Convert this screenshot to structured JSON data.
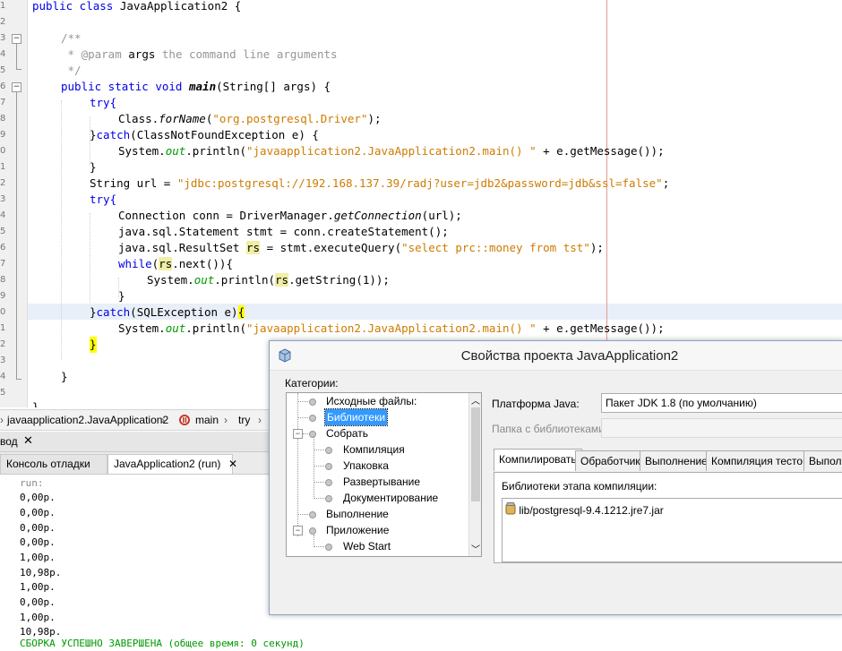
{
  "editor": {
    "gutter_numbers": [
      "1",
      "2",
      "3",
      "4",
      "5",
      "6",
      "7",
      "8",
      "9",
      "0",
      "1",
      "2",
      "3",
      "4",
      "5",
      "6",
      "7",
      "8",
      "9",
      "0",
      "1",
      "2",
      "3",
      "4",
      "5",
      "6"
    ],
    "lines": {
      "l1": {
        "kw": "public class ",
        "rest": "JavaApplication2 {"
      },
      "l3": "/**",
      "l4a": " * @param ",
      "l4b": "args",
      "l4c": " the command line arguments",
      "l5": " */",
      "l6a": "public static void ",
      "l6b": "main",
      "l6c": "(String[] args) {",
      "l7": "try{",
      "l8a": "Class.",
      "l8b": "forName",
      "l8c": "(",
      "l8d": "\"org.postgresql.Driver\"",
      "l8e": ");",
      "l9a": "}",
      "l9b": "catch",
      "l9c": "(ClassNotFoundException e) {",
      "l10a": "System.",
      "l10b": "out",
      "l10c": ".println(",
      "l10d": "\"javaapplication2.JavaApplication2.main() \"",
      "l10e": " + e.getMessage());",
      "l11": "}",
      "l12a": "String url = ",
      "l12b": "\"jdbc:postgresql://192.168.137.39/radj?user=jdb2&password=jdb&ssl=false\"",
      "l12c": ";",
      "l13": "try{",
      "l14a": "Connection conn = DriverManager.",
      "l14b": "getConnection",
      "l14c": "(url);",
      "l15": "java.sql.Statement stmt = conn.createStatement();",
      "l16a": "java.sql.ResultSet ",
      "l16b": "rs",
      "l16c": " = stmt.executeQuery(",
      "l16d": "\"select prc::money from tst\"",
      "l16e": ");",
      "l17a": "while",
      "l17b": "(",
      "l17c": "rs",
      "l17d": ".next()){",
      "l18a": "System.",
      "l18b": "out",
      "l18c": ".println(",
      "l18d": "rs",
      "l18e": ".getString(1));",
      "l19": "}",
      "l20a": "}",
      "l20b": "catch",
      "l20c": "(SQLException e)",
      "l20d": "{",
      "l21a": "System.",
      "l21b": "out",
      "l21c": ".println(",
      "l21d": "\"javaapplication2.JavaApplication2.main() \"",
      "l21e": " + e.getMessage());",
      "l22": "}",
      "l23": "}",
      "l24": "}"
    }
  },
  "breadcrumb": {
    "items": [
      "javaapplication2.JavaApplication2",
      "main",
      "try"
    ]
  },
  "output_window": {
    "title_fragment": "вод",
    "tabs": [
      "Консоль отладки",
      "JavaApplication2 (run)"
    ],
    "lines": [
      "run:",
      "0,00р.",
      "0,00р.",
      "0,00р.",
      "0,00р.",
      "1,00р.",
      "10,98р.",
      "1,00р.",
      "0,00р.",
      "1,00р.",
      "10,98р.",
      "СБОРКА УСПЕШНО ЗАВЕРШЕНА (общее время: 0 секунд)"
    ]
  },
  "dialog": {
    "title": "Свойства проекта JavaApplication2",
    "categories_label": "Категории:",
    "categories": [
      "Исходные файлы:",
      "Библиотеки",
      "Собрать",
      "Компиляция",
      "Упаковка",
      "Развертывание",
      "Документирование",
      "Выполнение",
      "Приложение",
      "Web Start"
    ],
    "platform_label": "Платформа Java:",
    "platform_value": "Пакет JDK 1.8 (по умолчанию)",
    "libfolder_label": "Папка с библиотеками:",
    "tabs": [
      "Компилировать",
      "Обработчик",
      "Выполнение",
      "Компиляция тестов",
      "Выполн"
    ],
    "compile_libs_label": "Библиотеки этапа компиляции:",
    "compile_libs": [
      "lib/postgresql-9.4.1212.jre7.jar"
    ]
  },
  "colors": {
    "keyword": "#0000e6",
    "string": "#ce7b00",
    "comment": "#969696",
    "field": "#009900",
    "success": "#009900",
    "selection": "#3399ff"
  }
}
